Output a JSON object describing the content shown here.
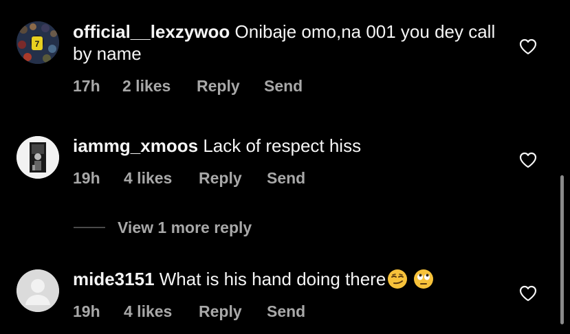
{
  "comments": [
    {
      "username": "official__lexzywoo",
      "text": "Onibaje  omo,na 001 you dey call by name",
      "time": "17h",
      "likes": "2 likes",
      "reply": "Reply",
      "send": "Send"
    },
    {
      "username": "iammg_xmoos",
      "text": "Lack of respect hiss",
      "time": "19h",
      "likes": "4 likes",
      "reply": "Reply",
      "send": "Send"
    },
    {
      "username": "mide3151",
      "text": "What is his hand doing there",
      "time": "19h",
      "likes": "4 likes",
      "reply": "Reply",
      "send": "Send"
    }
  ],
  "view_more_replies": "View 1 more reply",
  "icons": {
    "like": "heart-icon",
    "emoji_1": "smirking-face-emoji",
    "emoji_2": "face-with-rolling-eyes-emoji"
  },
  "colors": {
    "background": "#000000",
    "text": "#f5f5f5",
    "meta": "#a8a8a8"
  }
}
